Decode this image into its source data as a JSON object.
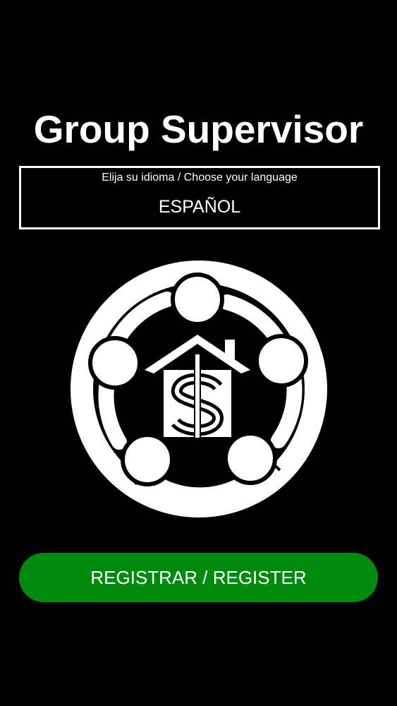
{
  "app": {
    "title": "Group Supervisor"
  },
  "language_selector": {
    "prompt": "Elija su idioma / Choose your language",
    "selected": "ESPAÑOL"
  },
  "logo": {
    "icon": "group-house-dollar-logo-icon"
  },
  "register_button": {
    "label": "REGISTRAR / REGISTER",
    "color": "#008a0e"
  },
  "colors": {
    "background": "#000000",
    "foreground": "#ffffff",
    "accent": "#008a0e"
  }
}
